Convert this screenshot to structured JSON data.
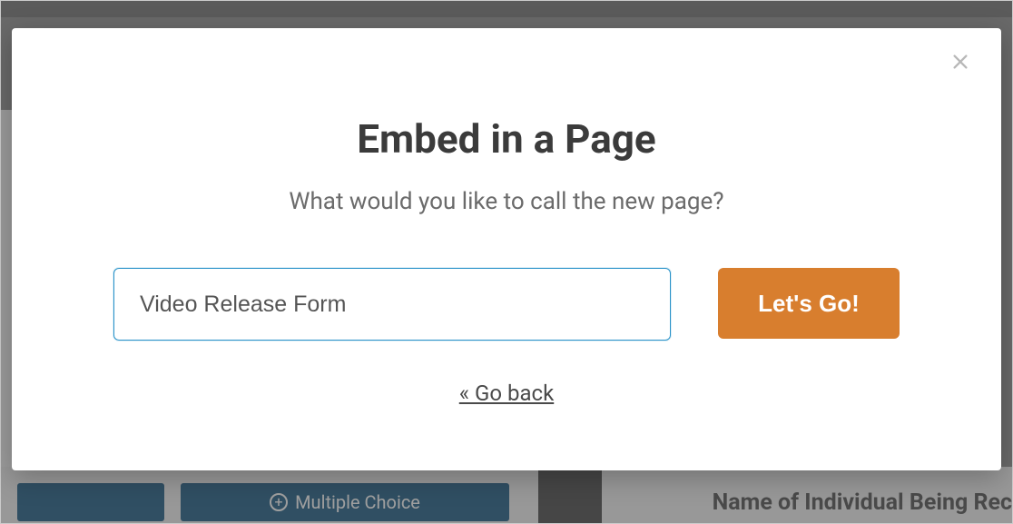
{
  "modal": {
    "title": "Embed in a Page",
    "subtitle": "What would you like to call the new page?",
    "input_value": "Video Release Form",
    "go_label": "Let's Go!",
    "back_label": "« Go back"
  },
  "background": {
    "multiple_choice_label": "Multiple Choice",
    "field_label": "Name of Individual Being Rec"
  }
}
